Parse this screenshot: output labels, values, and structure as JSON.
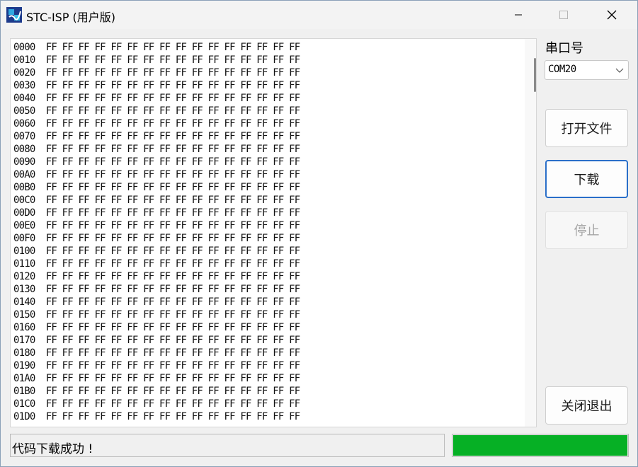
{
  "window": {
    "title": "STC-ISP (用户版)"
  },
  "hex_view": {
    "rows": [
      {
        "addr": "0000",
        "bytes": "FF FF FF FF FF FF FF FF FF FF FF FF FF FF FF FF"
      },
      {
        "addr": "0010",
        "bytes": "FF FF FF FF FF FF FF FF FF FF FF FF FF FF FF FF"
      },
      {
        "addr": "0020",
        "bytes": "FF FF FF FF FF FF FF FF FF FF FF FF FF FF FF FF"
      },
      {
        "addr": "0030",
        "bytes": "FF FF FF FF FF FF FF FF FF FF FF FF FF FF FF FF"
      },
      {
        "addr": "0040",
        "bytes": "FF FF FF FF FF FF FF FF FF FF FF FF FF FF FF FF"
      },
      {
        "addr": "0050",
        "bytes": "FF FF FF FF FF FF FF FF FF FF FF FF FF FF FF FF"
      },
      {
        "addr": "0060",
        "bytes": "FF FF FF FF FF FF FF FF FF FF FF FF FF FF FF FF"
      },
      {
        "addr": "0070",
        "bytes": "FF FF FF FF FF FF FF FF FF FF FF FF FF FF FF FF"
      },
      {
        "addr": "0080",
        "bytes": "FF FF FF FF FF FF FF FF FF FF FF FF FF FF FF FF"
      },
      {
        "addr": "0090",
        "bytes": "FF FF FF FF FF FF FF FF FF FF FF FF FF FF FF FF"
      },
      {
        "addr": "00A0",
        "bytes": "FF FF FF FF FF FF FF FF FF FF FF FF FF FF FF FF"
      },
      {
        "addr": "00B0",
        "bytes": "FF FF FF FF FF FF FF FF FF FF FF FF FF FF FF FF"
      },
      {
        "addr": "00C0",
        "bytes": "FF FF FF FF FF FF FF FF FF FF FF FF FF FF FF FF"
      },
      {
        "addr": "00D0",
        "bytes": "FF FF FF FF FF FF FF FF FF FF FF FF FF FF FF FF"
      },
      {
        "addr": "00E0",
        "bytes": "FF FF FF FF FF FF FF FF FF FF FF FF FF FF FF FF"
      },
      {
        "addr": "00F0",
        "bytes": "FF FF FF FF FF FF FF FF FF FF FF FF FF FF FF FF"
      },
      {
        "addr": "0100",
        "bytes": "FF FF FF FF FF FF FF FF FF FF FF FF FF FF FF FF"
      },
      {
        "addr": "0110",
        "bytes": "FF FF FF FF FF FF FF FF FF FF FF FF FF FF FF FF"
      },
      {
        "addr": "0120",
        "bytes": "FF FF FF FF FF FF FF FF FF FF FF FF FF FF FF FF"
      },
      {
        "addr": "0130",
        "bytes": "FF FF FF FF FF FF FF FF FF FF FF FF FF FF FF FF"
      },
      {
        "addr": "0140",
        "bytes": "FF FF FF FF FF FF FF FF FF FF FF FF FF FF FF FF"
      },
      {
        "addr": "0150",
        "bytes": "FF FF FF FF FF FF FF FF FF FF FF FF FF FF FF FF"
      },
      {
        "addr": "0160",
        "bytes": "FF FF FF FF FF FF FF FF FF FF FF FF FF FF FF FF"
      },
      {
        "addr": "0170",
        "bytes": "FF FF FF FF FF FF FF FF FF FF FF FF FF FF FF FF"
      },
      {
        "addr": "0180",
        "bytes": "FF FF FF FF FF FF FF FF FF FF FF FF FF FF FF FF"
      },
      {
        "addr": "0190",
        "bytes": "FF FF FF FF FF FF FF FF FF FF FF FF FF FF FF FF"
      },
      {
        "addr": "01A0",
        "bytes": "FF FF FF FF FF FF FF FF FF FF FF FF FF FF FF FF"
      },
      {
        "addr": "01B0",
        "bytes": "FF FF FF FF FF FF FF FF FF FF FF FF FF FF FF FF"
      },
      {
        "addr": "01C0",
        "bytes": "FF FF FF FF FF FF FF FF FF FF FF FF FF FF FF FF"
      },
      {
        "addr": "01D0",
        "bytes": "FF FF FF FF FF FF FF FF FF FF FF FF FF FF FF FF"
      }
    ]
  },
  "port": {
    "label": "串口号",
    "selected": "COM20"
  },
  "buttons": {
    "open_file": "打开文件",
    "download": "下载",
    "stop": "停止",
    "close_exit": "关闭退出"
  },
  "status": {
    "message": "代码下载成功 !"
  },
  "progress": {
    "fraction": 1.0,
    "color": "#06b025"
  },
  "colors": {
    "accent_border": "#2a6fc9",
    "disabled_text": "#a6a6a6"
  },
  "icons": {
    "app": "stc-isp-app-icon",
    "minimize": "minimize-icon",
    "maximize": "maximize-icon",
    "close": "close-icon",
    "dropdown": "chevron-down-icon"
  }
}
